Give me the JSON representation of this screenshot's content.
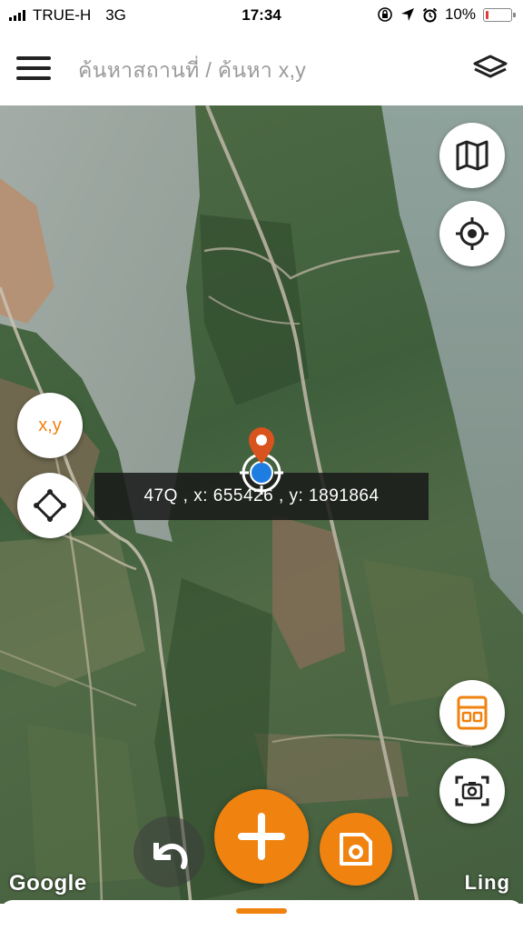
{
  "status_bar": {
    "carrier": "TRUE-H",
    "network": "3G",
    "time": "17:34",
    "battery": "10%",
    "battery_level": 0.1,
    "icons": [
      "signal-icon",
      "rotation-lock-icon",
      "location-arrow-icon",
      "alarm-icon",
      "battery-icon"
    ]
  },
  "header": {
    "search_placeholder": "ค้นหาสถานที่ / ค้นหา x,y",
    "menu_icon": "hamburger-menu-icon",
    "layers_icon": "layers-icon"
  },
  "map": {
    "coordinate_readout": "47Q , x: 655426 , y: 1891864",
    "xy_button_label": "x,y",
    "google_attribution": "Google",
    "brand_label": "Ling",
    "accent_color": "#f0820f",
    "buttons": {
      "map_type": "map-icon",
      "my_location": "crosshair-icon",
      "shape": "diamond-icon",
      "save_panel": "storage-icon",
      "capture": "camera-capture-icon",
      "undo": "undo-icon",
      "add": "plus-icon",
      "save": "save-icon"
    }
  }
}
